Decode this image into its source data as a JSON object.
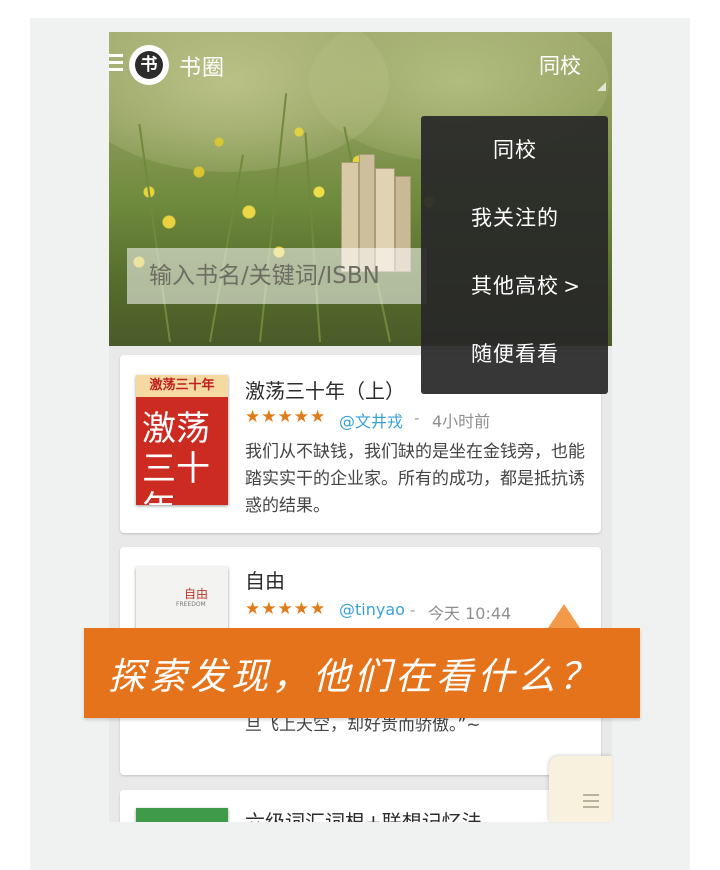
{
  "app": {
    "title": "书圈",
    "logo_glyph": "书",
    "scope_label": "同校"
  },
  "search": {
    "placeholder": "输入书名/关键词/ISBN"
  },
  "dropdown": {
    "items": [
      {
        "label": "同校"
      },
      {
        "label": "我关注的"
      },
      {
        "label": "其他高校",
        "chevron": ">"
      },
      {
        "label": "随便看看"
      }
    ]
  },
  "feed": {
    "items": [
      {
        "title": "激荡三十年（上）",
        "rating": 5,
        "stars": "★★★★★",
        "user": "@文井戎",
        "separator": "-",
        "time": "4小时前",
        "excerpt": "我们从不缺钱，我们缺的是坐在金钱旁，也能踏实实干的企业家。所有的成功，都是抵抗诱惑的结果。",
        "cover": {
          "band": "激荡三十年",
          "calligraphy": "激荡三十年"
        }
      },
      {
        "title": "自由",
        "rating": 4.5,
        "stars": "★★★★★",
        "user": "@tinyao",
        "separator": "-",
        "time": "今天 10:44",
        "excerpt": "“自由”或许是我们一直在追求却无从到达的一个命运，它使…被…一种鸟，它们在地面上谦卑而鬼祟，一如它们那泥泞的生存环境，但一旦飞上天空，却好贵而骄傲。”~",
        "cover": {
          "title": "自由",
          "subtitle": "FREEDOM"
        }
      },
      {
        "title": "六级词汇词根+联想记忆法"
      }
    ]
  },
  "banner": {
    "text": "探索发现，他们在看什么？"
  },
  "colors": {
    "accent_orange": "#e5731b",
    "star_orange": "#e07b19",
    "link_blue": "#39a1d3",
    "dropdown_bg": "#282828"
  }
}
